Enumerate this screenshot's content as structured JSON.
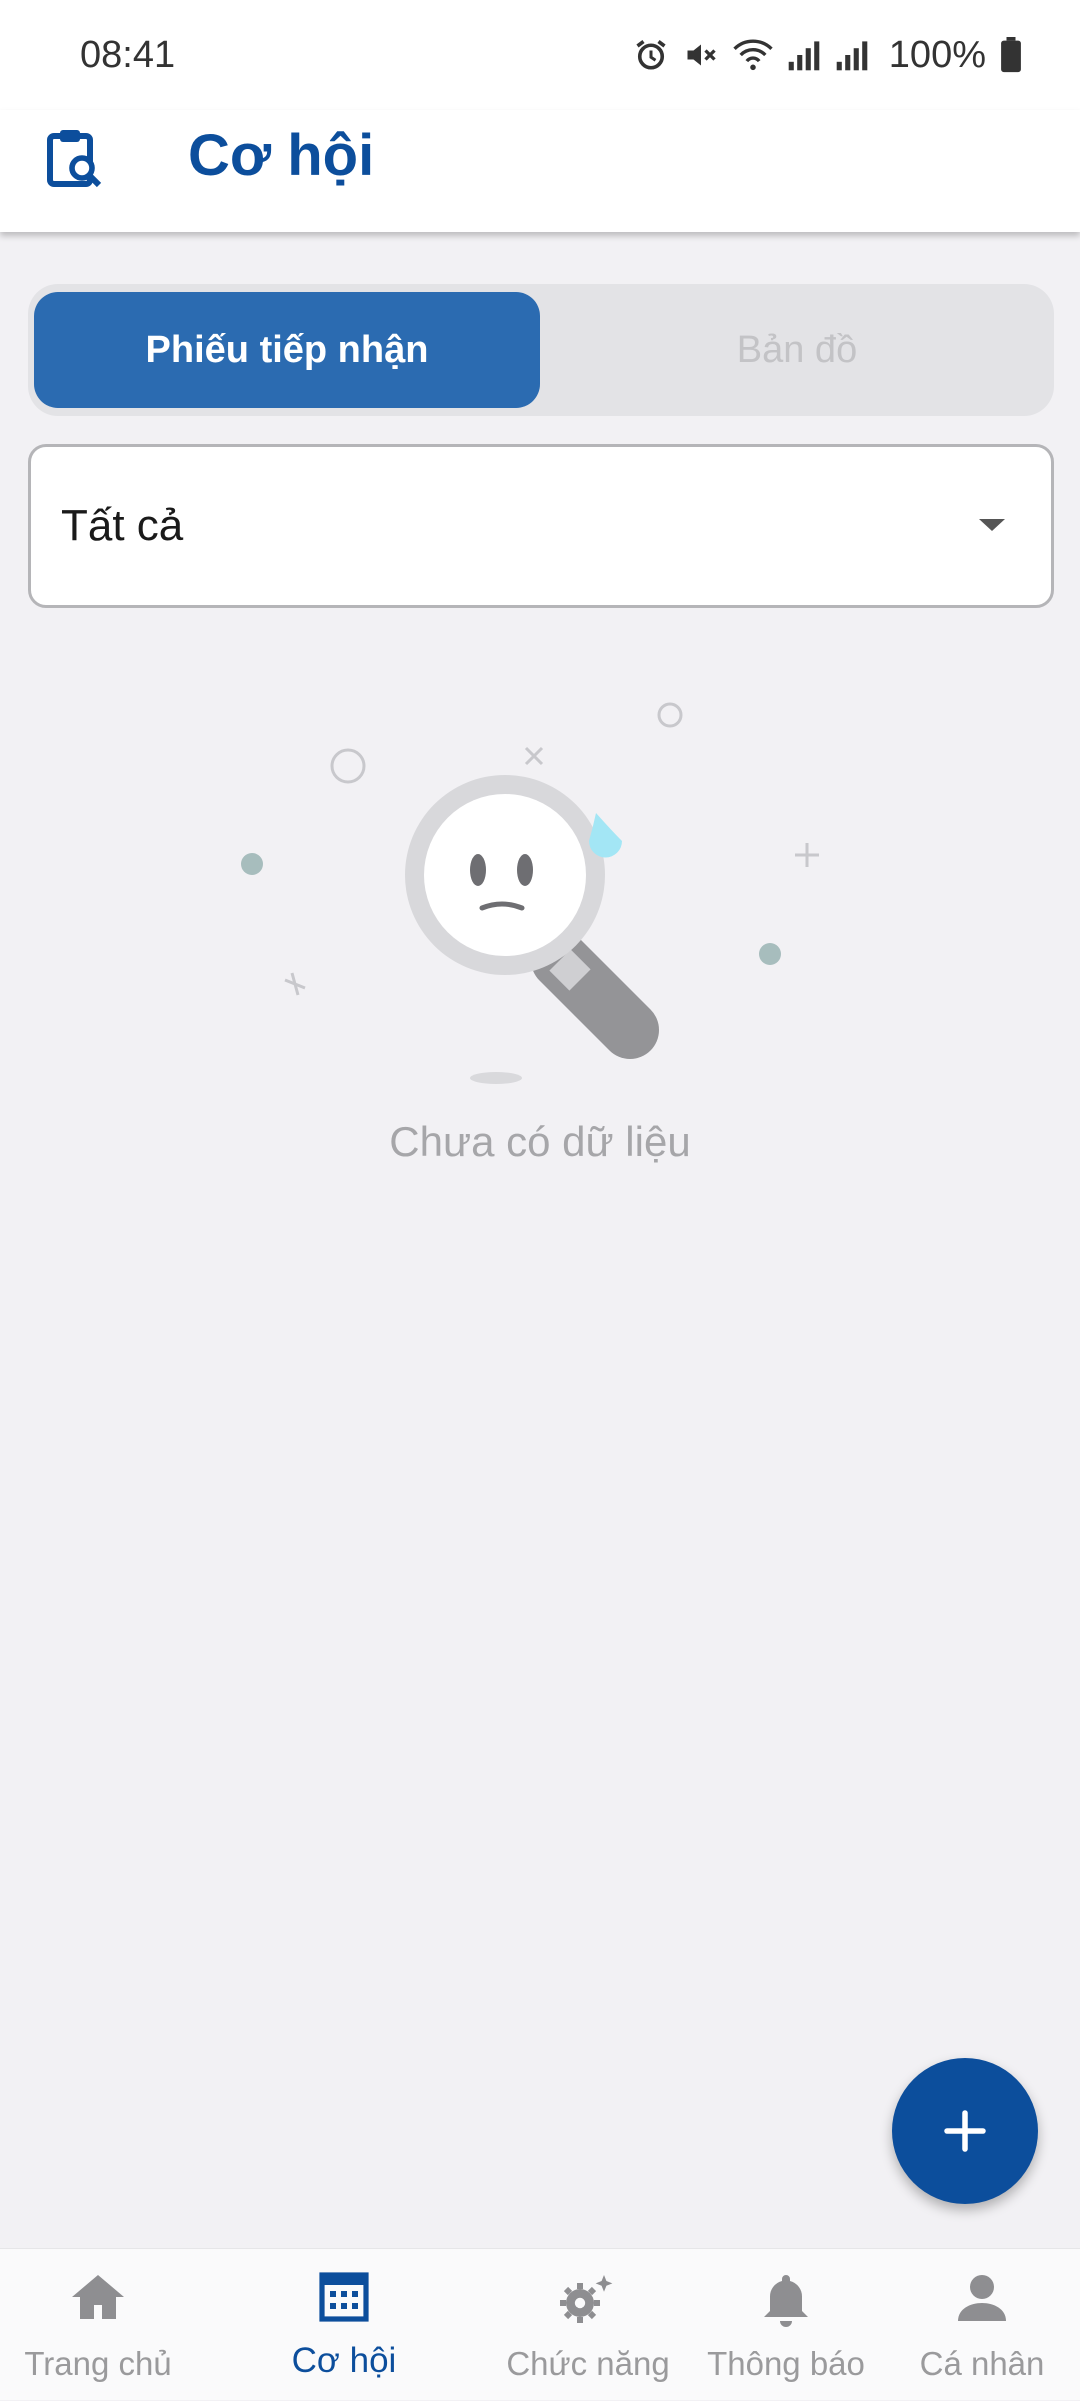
{
  "status_bar": {
    "time": "08:41",
    "battery": "100%"
  },
  "header": {
    "title": "Cơ hội",
    "icon": "clipboard-search-icon"
  },
  "segment": {
    "active_label": "Phiếu tiếp nhận",
    "inactive_label": "Bản đồ"
  },
  "filter": {
    "selected": "Tất cả"
  },
  "empty_state": {
    "message": "Chưa có dữ liệu"
  },
  "fab": {
    "icon": "plus-icon"
  },
  "bottom_nav": {
    "items": [
      {
        "label": "Trang chủ",
        "icon": "home-icon",
        "active": false
      },
      {
        "label": "Cơ hội",
        "icon": "grid-calendar-icon",
        "active": true
      },
      {
        "label": "Chức năng",
        "icon": "gears-icon",
        "active": false
      },
      {
        "label": "Thông báo",
        "icon": "bell-icon",
        "active": false
      },
      {
        "label": "Cá nhân",
        "icon": "person-icon",
        "active": false
      }
    ]
  },
  "colors": {
    "primary": "#0c4e9c",
    "segment_active": "#2b6bb1",
    "background": "#f2f1f4",
    "inactive_text": "#9a9a9c"
  }
}
